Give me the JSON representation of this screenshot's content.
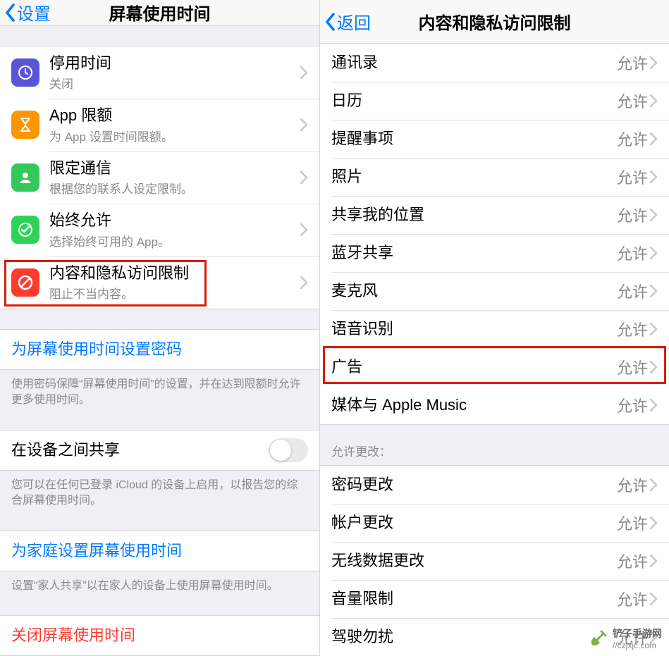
{
  "left": {
    "back_label": "设置",
    "title": "屏幕使用时间",
    "items": [
      {
        "title": "停用时间",
        "sub": "关闭",
        "icon": "downtime-icon",
        "bg": "bg-purple"
      },
      {
        "title": "App 限额",
        "sub": "为 App 设置时间限额。",
        "icon": "hourglass-icon",
        "bg": "bg-orange"
      },
      {
        "title": "限定通信",
        "sub": "根据您的联系人设定限制。",
        "icon": "contact-limit-icon",
        "bg": "bg-green"
      },
      {
        "title": "始终允许",
        "sub": "选择始终可用的 App。",
        "icon": "always-allow-icon",
        "bg": "bg-green2"
      },
      {
        "title": "内容和隐私访问限制",
        "sub": "阻止不当内容。",
        "icon": "no-entry-icon",
        "bg": "bg-red",
        "highlight": true
      }
    ],
    "passcode_label": "为屏幕使用时间设置密码",
    "passcode_footer": "使用密码保障“屏幕使用时间”的设置，并在达到限额时允许更多使用时间。",
    "share_label": "在设备之间共享",
    "share_footer": "您可以在任何已登录 iCloud 的设备上启用，以报告您的综合屏幕使用时间。",
    "family_label": "为家庭设置屏幕使用时间",
    "family_footer": "设置“家人共享”以在家人的设备上使用屏幕使用时间。",
    "turnoff_label": "关闭屏幕使用时间"
  },
  "right": {
    "back_label": "返回",
    "title": "内容和隐私访问限制",
    "allow_value": "允许",
    "items1": [
      {
        "title": "通讯录"
      },
      {
        "title": "日历"
      },
      {
        "title": "提醒事项"
      },
      {
        "title": "照片"
      },
      {
        "title": "共享我的位置"
      },
      {
        "title": "蓝牙共享"
      },
      {
        "title": "麦克风"
      },
      {
        "title": "语音识别"
      },
      {
        "title": "广告",
        "highlight": true
      },
      {
        "title": "媒体与 Apple Music"
      }
    ],
    "section_header": "允许更改：",
    "items2": [
      {
        "title": "密码更改"
      },
      {
        "title": "帐户更改"
      },
      {
        "title": "无线数据更改"
      },
      {
        "title": "音量限制"
      },
      {
        "title": "驾驶勿扰"
      }
    ]
  },
  "watermark": {
    "brand": "铲子手游网",
    "url": "//czjxjc.com"
  }
}
